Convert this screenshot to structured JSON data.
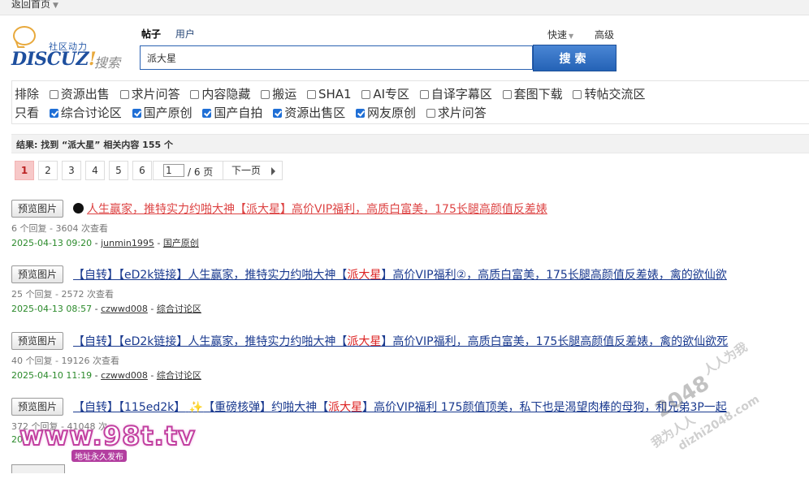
{
  "topbar": {
    "back_label": "返回首页",
    "back_arrow": "▼"
  },
  "logo": {
    "slogan": "社区动力",
    "brand": "DISCUZ",
    "bang": "!",
    "sub": "搜索"
  },
  "search": {
    "tabs": [
      "帖子",
      "用户"
    ],
    "quick_label": "快速",
    "quick_arrow": "▼",
    "advanced_label": "高级",
    "query": "派大星",
    "button_label": "搜索"
  },
  "filters": {
    "exclude_label": "排除",
    "exclude": [
      {
        "label": "资源出售",
        "checked": false
      },
      {
        "label": "求片问答",
        "checked": false
      },
      {
        "label": "内容隐藏",
        "checked": false
      },
      {
        "label": "搬运",
        "checked": false
      },
      {
        "label": "SHA1",
        "checked": false
      },
      {
        "label": "AI专区",
        "checked": false
      },
      {
        "label": "自译字幕区",
        "checked": false
      },
      {
        "label": "套图下载",
        "checked": false
      },
      {
        "label": "转帖交流区",
        "checked": false
      }
    ],
    "only_label": "只看",
    "only": [
      {
        "label": "综合讨论区",
        "checked": true
      },
      {
        "label": "国产原创",
        "checked": true
      },
      {
        "label": "国产自拍",
        "checked": true
      },
      {
        "label": "资源出售区",
        "checked": true
      },
      {
        "label": "网友原创",
        "checked": true
      },
      {
        "label": "求片问答",
        "checked": false
      }
    ]
  },
  "result": {
    "text": "结果: 找到 “派大星” 相关内容 155 个"
  },
  "pager": {
    "pages": [
      "1",
      "2",
      "3",
      "4",
      "5",
      "6"
    ],
    "current": "1",
    "jump_value": "1",
    "total_label": "/ 6 页",
    "next_label": "下一页"
  },
  "results": [
    {
      "preview_label": "预览图片",
      "title_pre": "人生赢家，推特实力约啪大神【",
      "title_hl": "派大星",
      "title_post": "】高价VIP福利，高质白富美，175长腿高颜值反差婊",
      "meta": "6 个回复 - 3604 次查看",
      "date": "2025-04-13 09:20",
      "author": "junmin1995",
      "forum": "国产原创"
    },
    {
      "preview_label": "预览图片",
      "title_pre": "【自转】【eD2k链接】人生赢家，推特实力约啪大神【",
      "title_hl": "派大星",
      "title_post": "】高价VIP福利②，高质白富美，175长腿高颜值反差婊，禽的欲仙欲",
      "meta": "25 个回复 - 2572 次查看",
      "date": "2025-04-13 08:57",
      "author": "czwwd008",
      "forum": "综合讨论区"
    },
    {
      "preview_label": "预览图片",
      "title_pre": "【自转】【eD2k链接】人生赢家，推特实力约啪大神【",
      "title_hl": "派大星",
      "title_post": "】高价VIP福利，高质白富美，175长腿高颜值反差婊，禽的欲仙欲死",
      "meta": "40 个回复 - 19126 次查看",
      "date": "2025-04-10 11:19",
      "author": "czwwd008",
      "forum": "综合讨论区"
    },
    {
      "preview_label": "预览图片",
      "title_pre": "【自转】【115ed2k】",
      "title_mid": "【重磅核弹】约啪大神【",
      "title_hl": "派大星",
      "title_post": "】高价VIP福利 175颜值顶美，私下也是渴望肉棒的母狗，和兄弟3P一起",
      "meta": "372 个回复 - 41048 次",
      "date": "20",
      "author": "",
      "forum": ""
    }
  ],
  "watermarks": {
    "site": "www.98t.tv",
    "site_sub": "地址永久发布",
    "big": "2048",
    "line1": "人人为我",
    "line2": "我为人人",
    "line3": "dizhi2048.com"
  }
}
